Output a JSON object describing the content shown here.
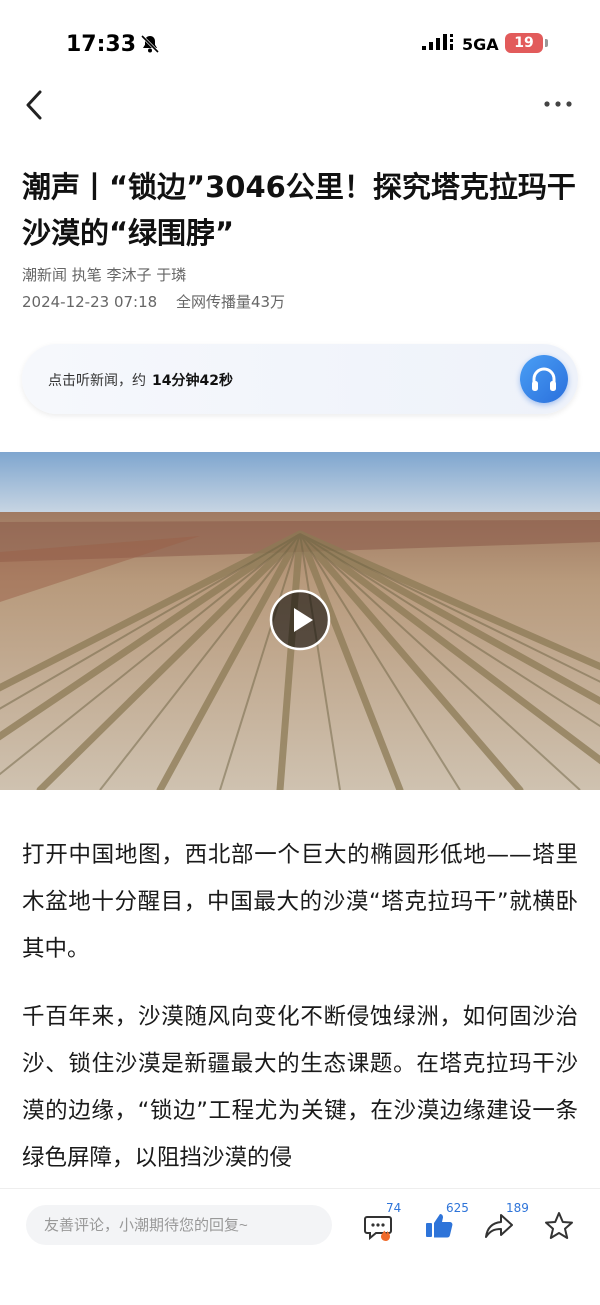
{
  "status_bar": {
    "time": "17:33",
    "network": "5GA",
    "battery": "19"
  },
  "article": {
    "title": "潮声丨“锁边”3046公里！探究塔克拉玛干沙漠的“绿围脖”",
    "source_line": "潮新闻  执笔 李沐子 于璘",
    "date": "2024-12-23 07:18",
    "reach": "全网传播量43万"
  },
  "audio": {
    "prompt": "点击听新闻，约",
    "duration": "14分钟42秒"
  },
  "body": {
    "p1": "打开中国地图，西北部一个巨大的椭圆形低地——塔里木盆地十分醒目，中国最大的沙漠“塔克拉玛干”就横卧其中。",
    "p2": "千百年来，沙漠随风向变化不断侵蚀绿洲，如何固沙治沙、锁住沙漠是新疆最大的生态课题。在塔克拉玛干沙漠的边缘，“锁边”工程尤为关键，在沙漠边缘建设一条绿色屏障，以阻挡沙漠的侵"
  },
  "bottom_bar": {
    "comment_placeholder": "友善评论，小潮期待您的回复~",
    "comment_count": "74",
    "like_count": "625",
    "share_count": "189"
  },
  "colors": {
    "accent": "#2e74d9",
    "battery": "#e25b5b"
  }
}
